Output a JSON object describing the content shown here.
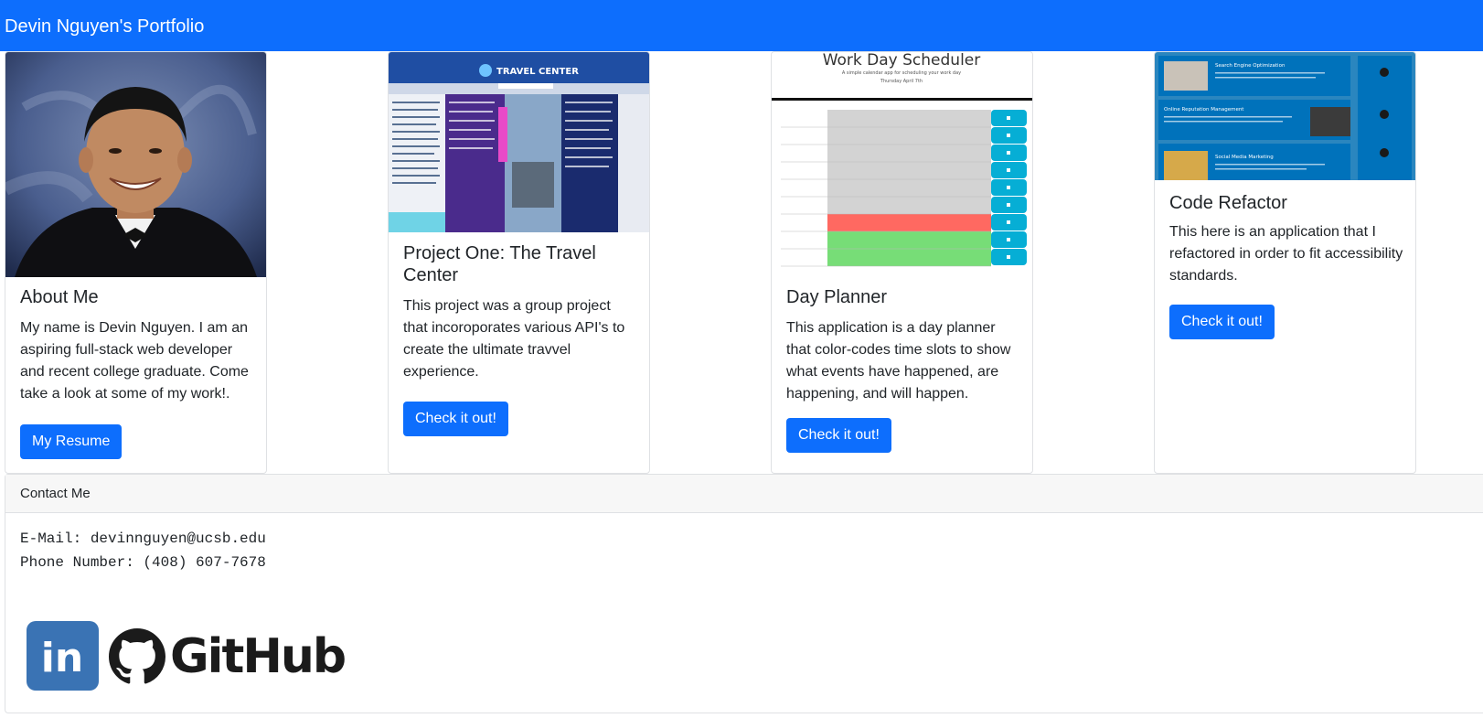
{
  "navbar": {
    "brand": "Devin Nguyen's Portfolio"
  },
  "cards": [
    {
      "title": "About Me",
      "text": "My name is Devin Nguyen. I am an aspiring full-stack web developer and recent college graduate. Come take a look at some of my work!.",
      "button": "My Resume"
    },
    {
      "title": "Project One: The Travel Center",
      "text": "This project was a group project that incoroporates various API's to create the ultimate travvel experience.",
      "button": "Check it out!"
    },
    {
      "title": "Day Planner",
      "text": "This application is a day planner that color-codes time slots to show what events have happened, are happening, and will happen.",
      "button": "Check it out!"
    },
    {
      "title": "Code Refactor",
      "text": "This here is an application that I refactored in order to fit accessibility standards.",
      "button": "Check it out!"
    }
  ],
  "thumbnails": {
    "travel": {
      "title": "TRAVEL CENTER"
    },
    "scheduler": {
      "title": "Work Day Scheduler",
      "subtitle": "A simple calendar app for scheduling your work day",
      "date": "Thursday April 7th"
    },
    "refactor": {
      "sections": [
        "Search Engine Optimization",
        "Online Reputation Management",
        "Social Media Marketing"
      ]
    }
  },
  "contact": {
    "header": "Contact Me",
    "email": "E-Mail: devinnguyen@ucsb.edu",
    "phone": "Phone Number: (408) 607-7678",
    "linkedin_text": "in",
    "github_text": "GitHub"
  },
  "colors": {
    "primary": "#0d6efd",
    "linkedin": "#3a73b4",
    "past": "#d3d3d3",
    "present": "#ff6961",
    "future": "#77dd77",
    "save": "#06aed5"
  },
  "icons": {
    "linkedin": "linkedin-logo",
    "github": "github-logo"
  }
}
